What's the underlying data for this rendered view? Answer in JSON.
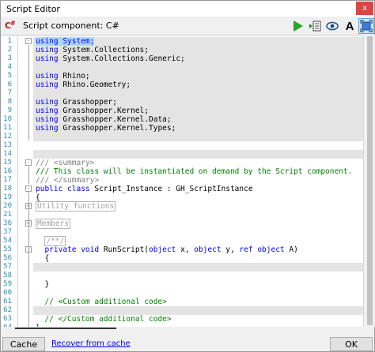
{
  "window": {
    "title": "Script Editor",
    "close_glyph": "x"
  },
  "toolbar": {
    "logo_text": "C#",
    "component_label": "Script component: C#",
    "buttons": [
      "run-icon",
      "export-icon",
      "preview-icon",
      "font-icon",
      "fit-icon"
    ],
    "font_glyph": "A"
  },
  "editor": {
    "lines": [
      {
        "num": "1",
        "fold": "-",
        "shaded": true,
        "parts": [
          {
            "t": "using System;",
            "c": "sel"
          }
        ]
      },
      {
        "num": "2",
        "fold": "",
        "shaded": true,
        "parts": [
          {
            "t": "using",
            "c": "kw"
          },
          {
            "t": " System.Collections;",
            "c": ""
          }
        ]
      },
      {
        "num": "3",
        "fold": "",
        "shaded": true,
        "parts": [
          {
            "t": "using",
            "c": "kw"
          },
          {
            "t": " System.Collections.Generic;",
            "c": ""
          }
        ]
      },
      {
        "num": "4",
        "fold": "",
        "shaded": true,
        "parts": []
      },
      {
        "num": "5",
        "fold": "",
        "shaded": true,
        "parts": [
          {
            "t": "using",
            "c": "kw"
          },
          {
            "t": " Rhino;",
            "c": ""
          }
        ]
      },
      {
        "num": "6",
        "fold": "",
        "shaded": true,
        "parts": [
          {
            "t": "using",
            "c": "kw"
          },
          {
            "t": " Rhino.Geometry;",
            "c": ""
          }
        ]
      },
      {
        "num": "7",
        "fold": "",
        "shaded": true,
        "parts": []
      },
      {
        "num": "8",
        "fold": "",
        "shaded": true,
        "parts": [
          {
            "t": "using",
            "c": "kw"
          },
          {
            "t": " Grasshopper;",
            "c": ""
          }
        ]
      },
      {
        "num": "9",
        "fold": "",
        "shaded": true,
        "parts": [
          {
            "t": "using",
            "c": "kw"
          },
          {
            "t": " Grasshopper.Kernel;",
            "c": ""
          }
        ]
      },
      {
        "num": "10",
        "fold": "",
        "shaded": true,
        "parts": [
          {
            "t": "using",
            "c": "kw"
          },
          {
            "t": " Grasshopper.Kernel.Data;",
            "c": ""
          }
        ]
      },
      {
        "num": "11",
        "fold": "",
        "shaded": true,
        "parts": [
          {
            "t": "using",
            "c": "kw"
          },
          {
            "t": " Grasshopper.Kernel.Types;",
            "c": ""
          }
        ]
      },
      {
        "num": "12",
        "fold": "",
        "shaded": true,
        "parts": []
      },
      {
        "num": "13",
        "fold": "",
        "shaded": false,
        "parts": []
      },
      {
        "num": "14",
        "fold": "",
        "shaded": true,
        "parts": []
      },
      {
        "num": "15",
        "fold": "-",
        "shaded": false,
        "parts": [
          {
            "t": "/// <summary>",
            "c": "cmg"
          }
        ]
      },
      {
        "num": "16",
        "fold": "",
        "shaded": false,
        "parts": [
          {
            "t": "/// This class will be instantiated on demand by the Script component.",
            "c": "cm"
          }
        ]
      },
      {
        "num": "17",
        "fold": "",
        "shaded": false,
        "parts": [
          {
            "t": "/// </summary>",
            "c": "cmg"
          }
        ]
      },
      {
        "num": "18",
        "fold": "-",
        "shaded": false,
        "parts": [
          {
            "t": "public class",
            "c": "kw"
          },
          {
            "t": " Script_Instance : GH_ScriptInstance",
            "c": ""
          }
        ]
      },
      {
        "num": "19",
        "fold": "",
        "shaded": false,
        "parts": [
          {
            "t": "{",
            "c": ""
          }
        ]
      },
      {
        "num": "20",
        "fold": "+",
        "shaded": false,
        "parts": [
          {
            "t": "Utility functions",
            "c": "region"
          }
        ]
      },
      {
        "num": "21",
        "fold": "",
        "shaded": false,
        "parts": []
      },
      {
        "num": "36",
        "fold": "+",
        "shaded": false,
        "parts": [
          {
            "t": "Members",
            "c": "region"
          }
        ]
      },
      {
        "num": "37",
        "fold": "",
        "shaded": false,
        "parts": []
      },
      {
        "num": "54",
        "fold": "",
        "shaded": false,
        "parts": [
          {
            "t": "  ",
            "c": ""
          },
          {
            "t": "/**/",
            "c": "region"
          }
        ]
      },
      {
        "num": "55",
        "fold": "-",
        "shaded": false,
        "parts": [
          {
            "t": "  ",
            "c": ""
          },
          {
            "t": "private void",
            "c": "kw"
          },
          {
            "t": " RunScript(",
            "c": ""
          },
          {
            "t": "object",
            "c": "kw"
          },
          {
            "t": " x, ",
            "c": ""
          },
          {
            "t": "object",
            "c": "kw"
          },
          {
            "t": " y, ",
            "c": ""
          },
          {
            "t": "ref object",
            "c": "kw"
          },
          {
            "t": " A)",
            "c": ""
          }
        ]
      },
      {
        "num": "56",
        "fold": "",
        "shaded": false,
        "parts": [
          {
            "t": "  {",
            "c": ""
          }
        ]
      },
      {
        "num": "57",
        "fold": "",
        "shaded": true,
        "parts": []
      },
      {
        "num": "58",
        "fold": "",
        "shaded": false,
        "parts": []
      },
      {
        "num": "59",
        "fold": "",
        "shaded": false,
        "parts": [
          {
            "t": "  }",
            "c": ""
          }
        ]
      },
      {
        "num": "60",
        "fold": "",
        "shaded": false,
        "parts": []
      },
      {
        "num": "61",
        "fold": "",
        "shaded": false,
        "parts": [
          {
            "t": "  // <Custom additional code>",
            "c": "cm"
          }
        ]
      },
      {
        "num": "62",
        "fold": "",
        "shaded": true,
        "parts": []
      },
      {
        "num": "63",
        "fold": "",
        "shaded": false,
        "parts": [
          {
            "t": "  // </Custom additional code>",
            "c": "cm"
          }
        ]
      },
      {
        "num": "64",
        "fold": "",
        "shaded": false,
        "parts": [
          {
            "t": "}",
            "c": ""
          }
        ]
      }
    ]
  },
  "footer": {
    "cache_label": "Cache",
    "recover_label": "Recover from cache",
    "ok_label": "OK"
  },
  "colors": {
    "keyword": "#0000ff",
    "comment": "#008000",
    "comment_tag": "#808080",
    "line_number": "#2b91af",
    "selection": "#add6ff",
    "run_green": "#2aa52a"
  }
}
